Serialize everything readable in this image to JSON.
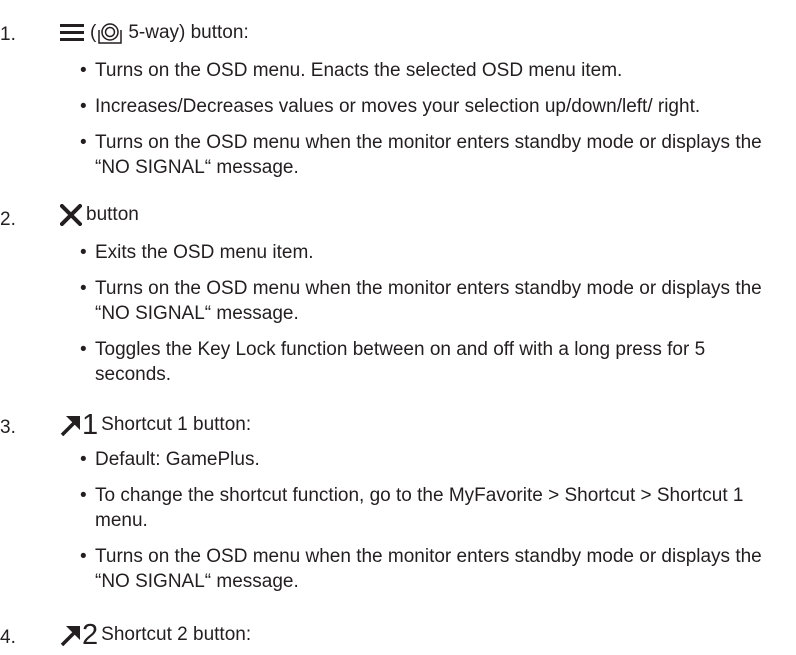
{
  "items": [
    {
      "number": "1.",
      "icon": "menu-icon",
      "sub_icon": "five-way-joystick-icon",
      "open_paren": "(",
      "label": "5-way) button:",
      "bullets": [
        "Turns on the OSD menu. Enacts the selected OSD menu item.",
        "Increases/Decreases values or moves your selection up/down/left/ right.",
        "Turns on the OSD menu when the monitor enters standby mode or displays the “NO SIGNAL“ message."
      ]
    },
    {
      "number": "2.",
      "icon": "close-x-icon",
      "label": "button",
      "bullets": [
        "Exits the OSD menu item.",
        "Turns on the OSD menu when the monitor enters standby mode or displays the “NO SIGNAL“ message.",
        "Toggles the Key Lock function between on and off with a long press for 5 seconds."
      ]
    },
    {
      "number": "3.",
      "icon": "shortcut-arrow-icon",
      "digit": "1",
      "label": "Shortcut 1 button:",
      "bullets": [
        "Default: GamePlus.",
        "To change the shortcut function, go to the MyFavorite > Shortcut > Shortcut 1 menu.",
        "Turns on the OSD menu when the monitor enters standby mode or displays the “NO SIGNAL“ message."
      ]
    },
    {
      "number": "4.",
      "icon": "shortcut-arrow-icon",
      "digit": "2",
      "label": "Shortcut 2 button:"
    }
  ]
}
